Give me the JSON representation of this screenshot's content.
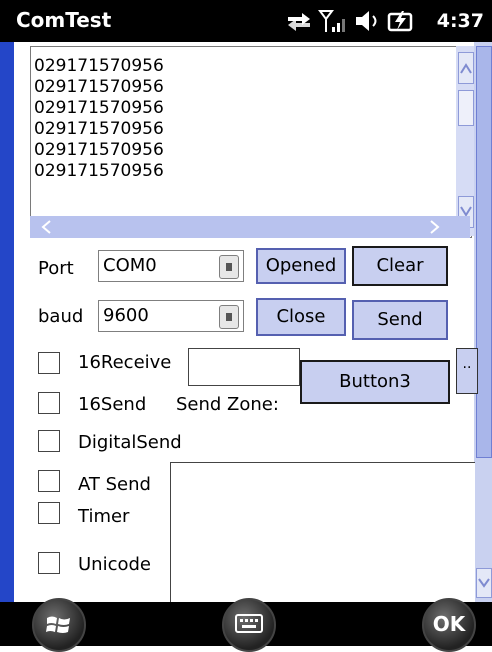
{
  "titlebar": {
    "title": "ComTest",
    "time": "4:37"
  },
  "output": {
    "lines": [
      "029171570956",
      "029171570956",
      "029171570956",
      "029171570956",
      "029171570956",
      "029171570956"
    ]
  },
  "port": {
    "label": "Port",
    "value": "COM0"
  },
  "baud": {
    "label": "baud",
    "value": "9600"
  },
  "buttons": {
    "opened": "Opened",
    "clear": "Clear",
    "close": "Close",
    "send": "Send",
    "button3": "Button3",
    "ellipsis": ".."
  },
  "checks": {
    "receive16": "16Receive",
    "send16": "16Send",
    "digitalsend": "DigitalSend",
    "atsend": "AT Send",
    "timer": "Timer",
    "unicode": "Unicode"
  },
  "send_zone_label": "Send Zone:",
  "softkeys": {
    "ok": "OK"
  }
}
